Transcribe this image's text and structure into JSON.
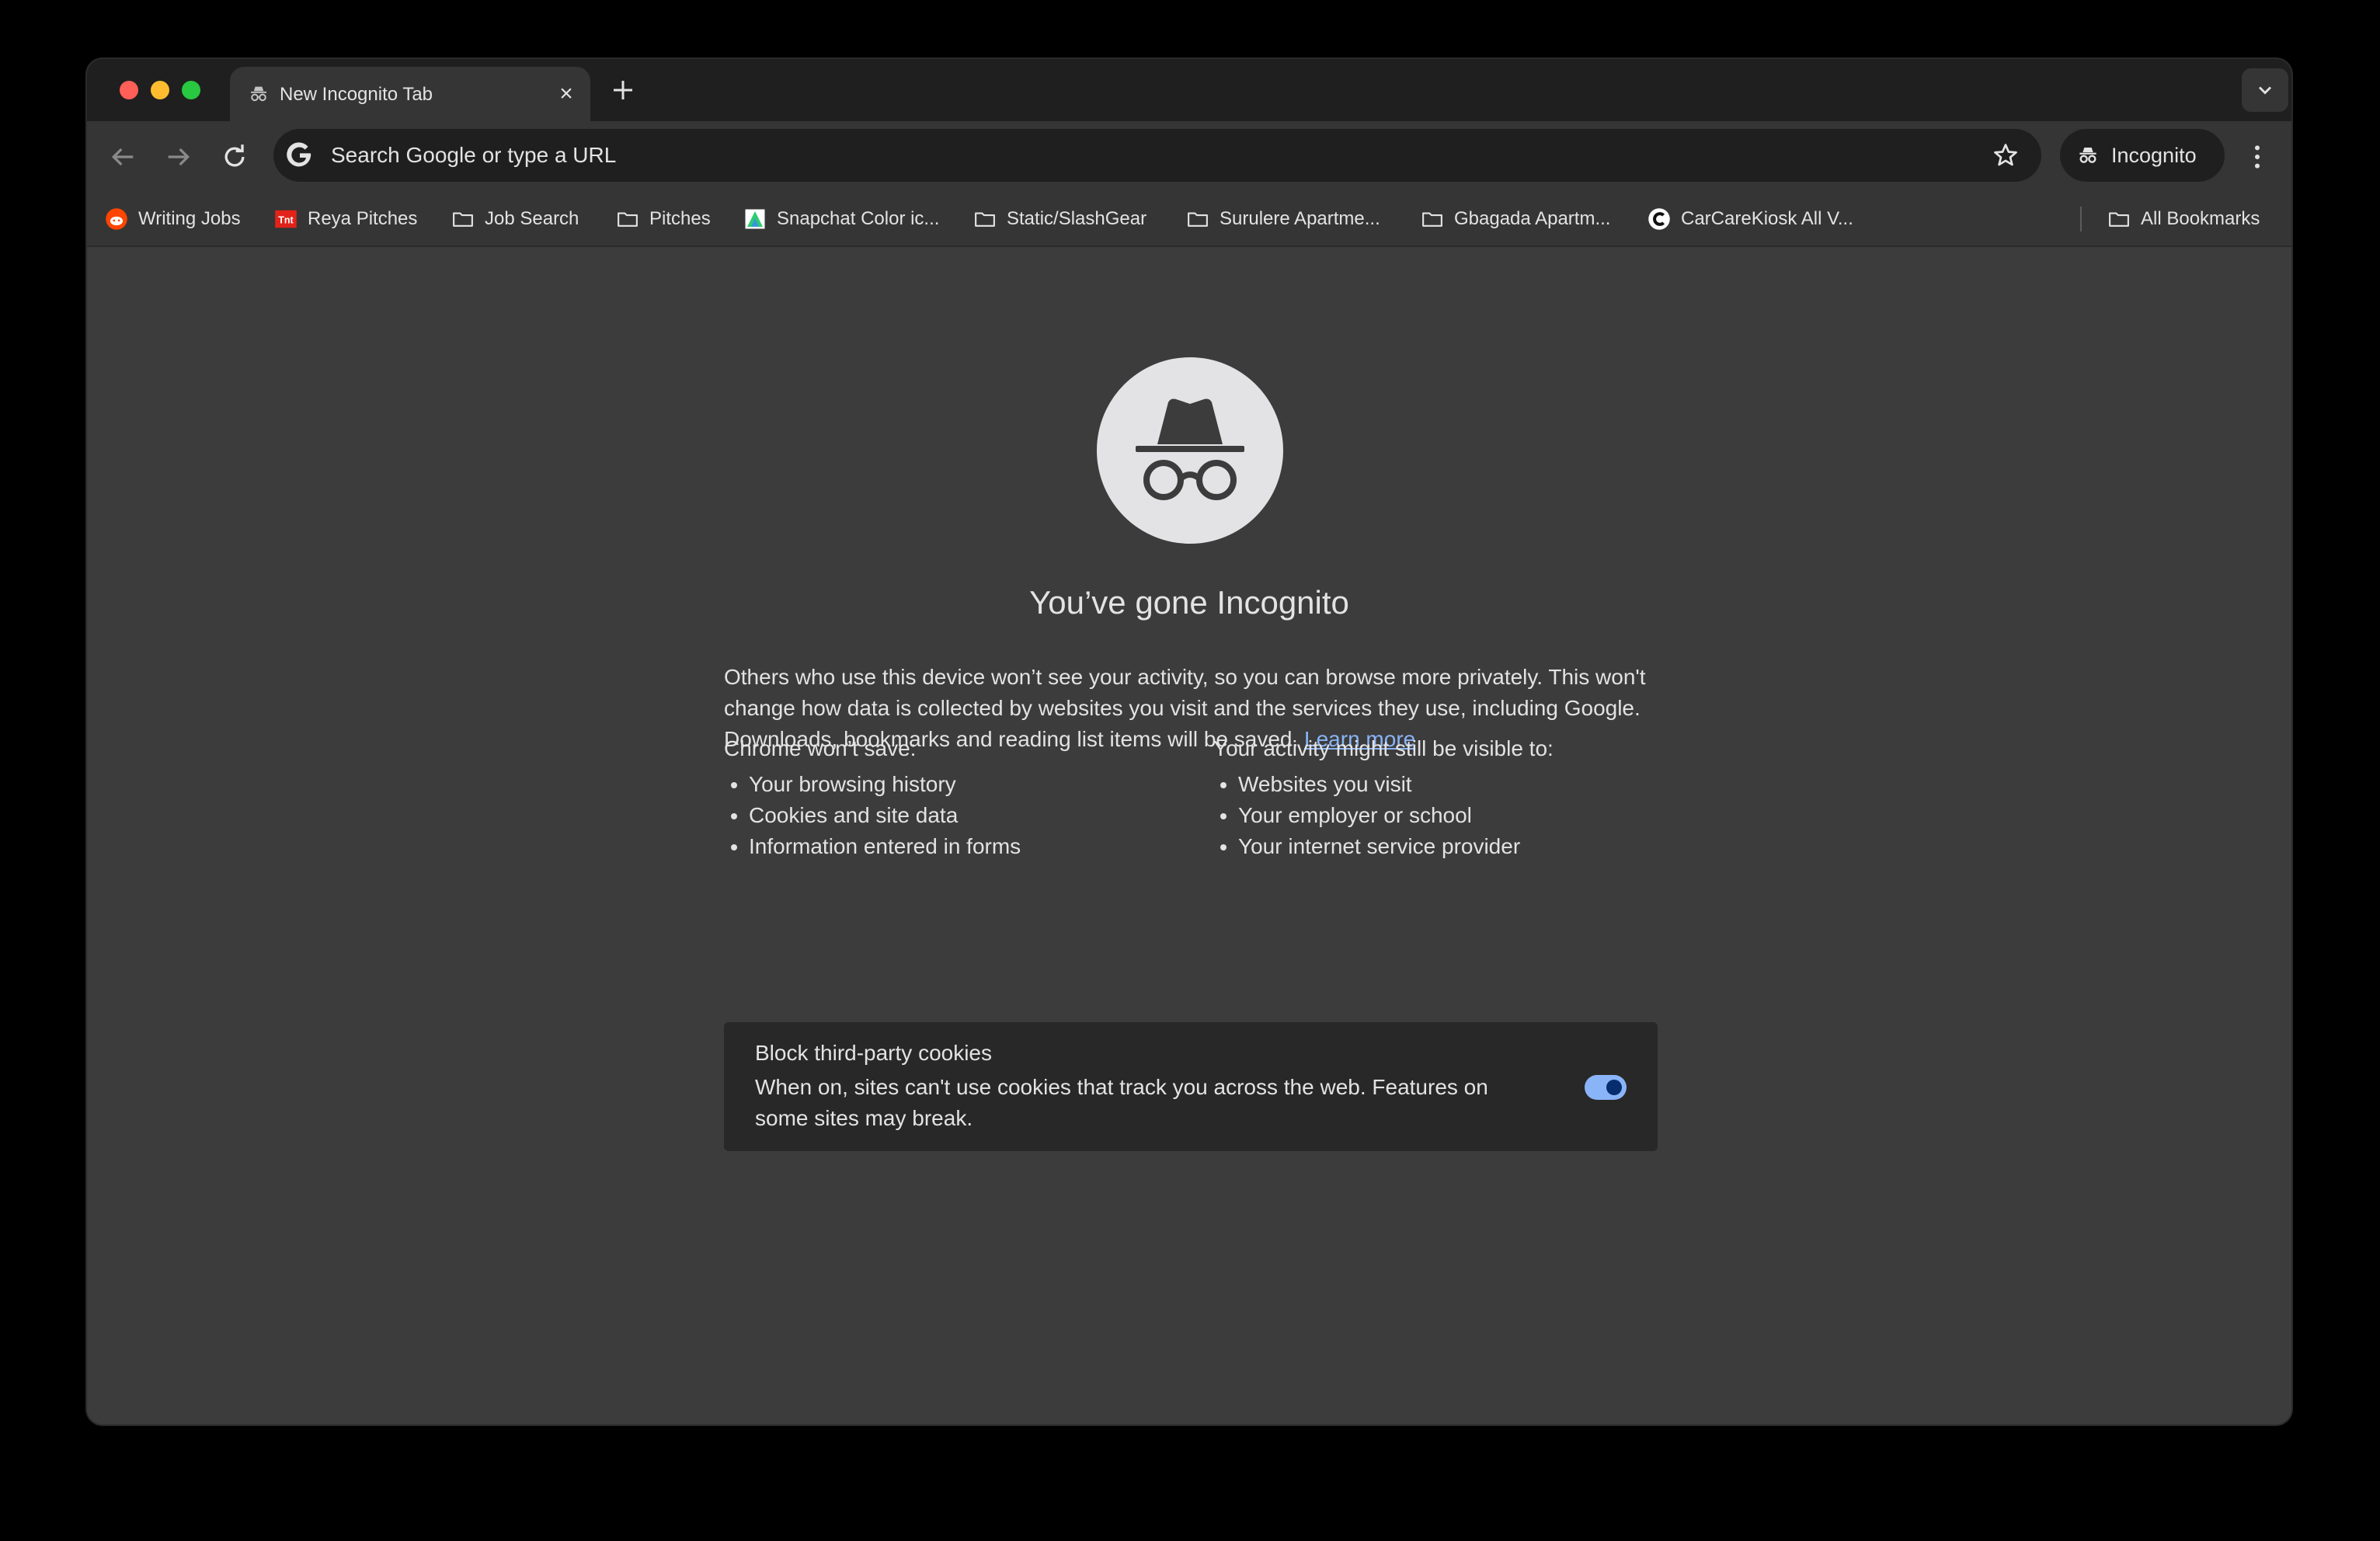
{
  "tab": {
    "title": "New Incognito Tab",
    "close": "×"
  },
  "omnibox": {
    "placeholder": "Search Google or type a URL"
  },
  "profile": {
    "label": "Incognito"
  },
  "bookmarks": [
    {
      "label": "Writing Jobs",
      "icon": "reddit-icon"
    },
    {
      "label": "Reya Pitches",
      "icon": "tnt-favicon"
    },
    {
      "label": "Job Search",
      "icon": "folder-icon"
    },
    {
      "label": "Pitches",
      "icon": "folder-icon"
    },
    {
      "label": "Snapchat Color ic...",
      "icon": "snapchat-favicon"
    },
    {
      "label": "Static/SlashGear",
      "icon": "folder-icon"
    },
    {
      "label": "Surulere Apartme...",
      "icon": "folder-icon"
    },
    {
      "label": "Gbagada Apartm...",
      "icon": "folder-icon"
    },
    {
      "label": "CarCareKiosk All V...",
      "icon": "carcarekiosk-favicon"
    }
  ],
  "all_bookmarks": "All Bookmarks",
  "page": {
    "title": "You’ve gone Incognito",
    "intro": "Others who use this device won’t see your activity, so you can browse more privately. This won't change how data is collected by websites you visit and the services they use, including Google. Downloads, bookmarks and reading list items will be saved.",
    "learn_more": "Learn more",
    "wont_save_title": "Chrome won’t save:",
    "wont_save": [
      "Your browsing history",
      "Cookies and site data",
      "Information entered in forms"
    ],
    "visible_title": "Your activity might still be visible to:",
    "visible": [
      "Websites you visit",
      "Your employer or school",
      "Your internet service provider"
    ],
    "cookies": {
      "title": "Block third-party cookies",
      "desc": "When on, sites can't use cookies that track you across the web. Features on some sites may break.",
      "enabled": true
    }
  },
  "colors": {
    "link": "#8ab4f8",
    "toggle_on": "#8ab4f8",
    "background": "#3c3c3c"
  }
}
